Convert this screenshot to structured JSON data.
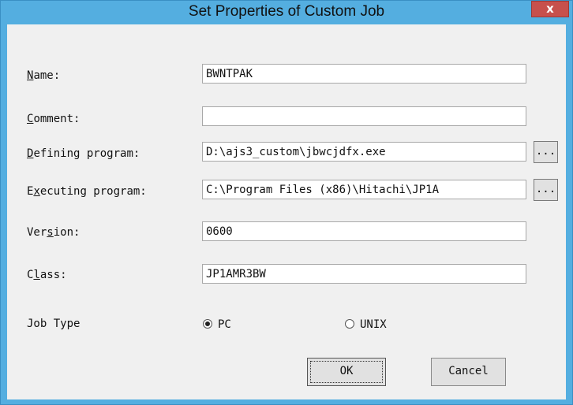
{
  "window": {
    "title": "Set Properties of Custom Job",
    "close_symbol": "x",
    "close_icon": "close-icon"
  },
  "fields": {
    "name": {
      "label_hotkey": "N",
      "label_rest": "ame:",
      "value": "BWNTPAK"
    },
    "comment": {
      "label_hotkey": "C",
      "label_rest": "omment:",
      "value": ""
    },
    "defining_program": {
      "label_pre": "",
      "label_hotkey": "D",
      "label_rest": "efining program:",
      "value": "D:\\ajs3_custom\\jbwcjdfx.exe",
      "browse_label": "..."
    },
    "executing_program": {
      "label_pre": "E",
      "label_hotkey": "x",
      "label_rest": "ecuting program:",
      "value": "C:\\Program Files (x86)\\Hitachi\\JP1A",
      "browse_label": "..."
    },
    "version": {
      "label_pre": "Ver",
      "label_hotkey": "s",
      "label_rest": "ion:",
      "value": "0600"
    },
    "class": {
      "label_pre": "C",
      "label_hotkey": "l",
      "label_rest": "ass:",
      "value": "JP1AMR3BW"
    }
  },
  "job_type": {
    "label": "Job Type",
    "options": [
      {
        "label": "PC",
        "selected": true
      },
      {
        "label": "UNIX",
        "selected": false
      }
    ]
  },
  "buttons": {
    "ok": "OK",
    "cancel": "Cancel"
  },
  "colors": {
    "frame": "#54aee0",
    "close": "#c7504c",
    "client": "#f0f0f0"
  }
}
